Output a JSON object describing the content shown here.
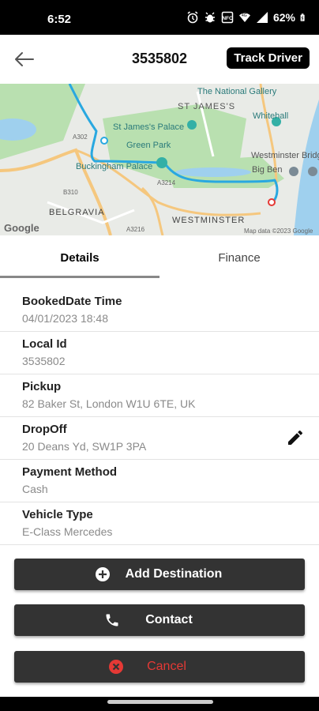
{
  "status_bar": {
    "time": "6:52",
    "battery": "62%",
    "icons": [
      "alarm-icon",
      "bug-icon",
      "nfc-icon",
      "wifi-icon",
      "signal-icon",
      "battery-icon"
    ]
  },
  "header": {
    "title": "3535802",
    "track_label": "Track Driver",
    "back_icon": "arrow-left-icon"
  },
  "map": {
    "labels": [
      "The National Gallery",
      "ST JAMES'S",
      "St James's Palace",
      "Whitehall",
      "Green Park",
      "Westminster Bridg",
      "Buckingham Palace",
      "Big Ben",
      "BELGRAVIA",
      "WESTMINSTER",
      "Google",
      "Map data ©2023 Google",
      "A3214",
      "A302",
      "B310",
      "A3216"
    ],
    "route_color": "#29a8e0"
  },
  "tabs": [
    {
      "label": "Details",
      "active": true
    },
    {
      "label": "Finance",
      "active": false
    }
  ],
  "details": [
    {
      "label": "BookedDate Time",
      "value": "04/01/2023 18:48"
    },
    {
      "label": "Local Id",
      "value": "3535802"
    },
    {
      "label": "Pickup",
      "value": "82 Baker St, London W1U 6TE, UK"
    },
    {
      "label": "DropOff",
      "value": "20 Deans Yd, SW1P 3PA",
      "editable": true
    },
    {
      "label": "Payment Method",
      "value": "Cash"
    },
    {
      "label": "Vehicle Type",
      "value": "E-Class Mercedes"
    }
  ],
  "actions": {
    "add_destination": "Add Destination",
    "contact": "Contact",
    "cancel": "Cancel"
  },
  "colors": {
    "cancel_text": "#e53935",
    "button_bg": "#333333"
  }
}
